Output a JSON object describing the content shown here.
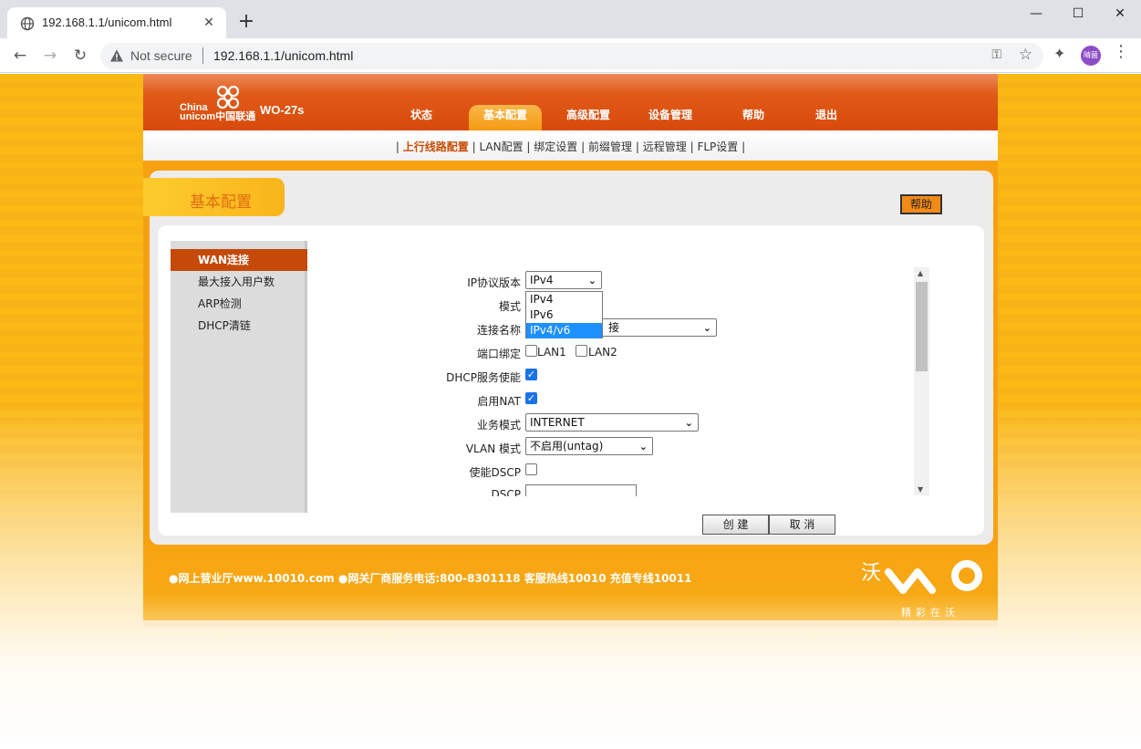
{
  "browser": {
    "tab_title": "192.168.1.1/unicom.html",
    "tab_close": "✕",
    "new_tab": "+",
    "window_min": "—",
    "window_max": "☐",
    "window_close": "✕",
    "back": "←",
    "forward": "→",
    "reload": "↻",
    "security_label": "Not secure",
    "url": "192.168.1.1/unicom.html",
    "profile_initials": "晴菌"
  },
  "header": {
    "brand_en_1": "China",
    "brand_en_2": "unicom中国联通",
    "model": "WO-27s",
    "nav": [
      {
        "label": "状态"
      },
      {
        "label": "基本配置"
      },
      {
        "label": "高级配置"
      },
      {
        "label": "设备管理"
      },
      {
        "label": "帮助"
      },
      {
        "label": "退出"
      }
    ]
  },
  "subnav": {
    "sep": "|",
    "items": [
      "上行线路配置",
      "LAN配置",
      "绑定设置",
      "前缀管理",
      "远程管理",
      "FLP设置"
    ]
  },
  "section": {
    "title": "基本配置",
    "help_label": "帮助"
  },
  "sidebar": {
    "items": [
      {
        "label": "WAN连接"
      },
      {
        "label": "最大接入用户数"
      },
      {
        "label": "ARP检测"
      },
      {
        "label": "DHCP清链"
      }
    ]
  },
  "form": {
    "ip_version_label": "IP协议版本",
    "ip_version_value": "IPv4",
    "ip_version_options": [
      "IPv4",
      "IPv6",
      "IPv4/v6"
    ],
    "mode_label": "模式",
    "conn_name_label": "连接名称",
    "conn_name_value_partial": "接",
    "port_bind_label": "端口绑定",
    "lan1_label": "LAN1",
    "lan2_label": "LAN2",
    "dhcp_label": "DHCP服务使能",
    "nat_label": "启用NAT",
    "service_mode_label": "业务模式",
    "service_mode_value": "INTERNET",
    "vlan_label": "VLAN 模式",
    "vlan_value": "不启用(untag)",
    "dscp_enable_label": "使能DSCP",
    "dscp_label": "DSCP"
  },
  "actions": {
    "create_label": "创 建",
    "cancel_label": "取 消"
  },
  "footer": {
    "text": "●网上营业厅www.10010.com ●网关厂商服务电话:800-8301118 客服热线10010 充值专线10011",
    "brand_mark": "沃",
    "slogan": "精彩在沃"
  },
  "colors": {
    "header_orange": "#d84a0b",
    "accent_orange": "#f7a112",
    "sidebar_active": "#c54a0a",
    "page_yellow": "#fab915"
  }
}
